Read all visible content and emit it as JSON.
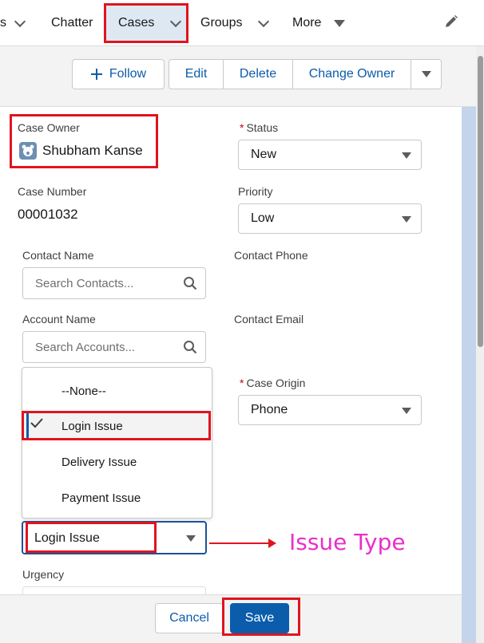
{
  "nav": {
    "partial_label": "s",
    "chatter": "Chatter",
    "cases": "Cases",
    "groups": "Groups",
    "more": "More"
  },
  "actions": {
    "follow": "Follow",
    "edit": "Edit",
    "delete": "Delete",
    "change_owner": "Change Owner"
  },
  "form": {
    "case_owner_label": "Case Owner",
    "case_owner_value": "Shubham Kanse",
    "status_label": "Status",
    "status_value": "New",
    "case_number_label": "Case Number",
    "case_number_value": "00001032",
    "priority_label": "Priority",
    "priority_value": "Low",
    "contact_name_label": "Contact Name",
    "contact_search_placeholder": "Search Contacts...",
    "contact_phone_label": "Contact Phone",
    "account_name_label": "Account Name",
    "account_search_placeholder": "Search Accounts...",
    "contact_email_label": "Contact Email",
    "case_origin_label": "Case Origin",
    "case_origin_value": "Phone",
    "issue_type_value": "Login Issue",
    "urgency_label": "Urgency"
  },
  "dropdown": {
    "options": [
      "--None--",
      "Login Issue",
      "Delivery Issue",
      "Payment Issue"
    ],
    "selected": "Login Issue"
  },
  "annotation": {
    "text": "Issue Type"
  },
  "footer": {
    "cancel": "Cancel",
    "save": "Save"
  },
  "colors": {
    "brand_blue": "#0b5cab",
    "highlight_red": "#e0141e",
    "annotation_pink": "#e830c8",
    "required_red": "#ba0517"
  },
  "icons": [
    "chevron-down-icon",
    "caret-down-icon",
    "pencil-icon",
    "plus-icon",
    "search-icon",
    "check-icon",
    "avatar-icon"
  ]
}
